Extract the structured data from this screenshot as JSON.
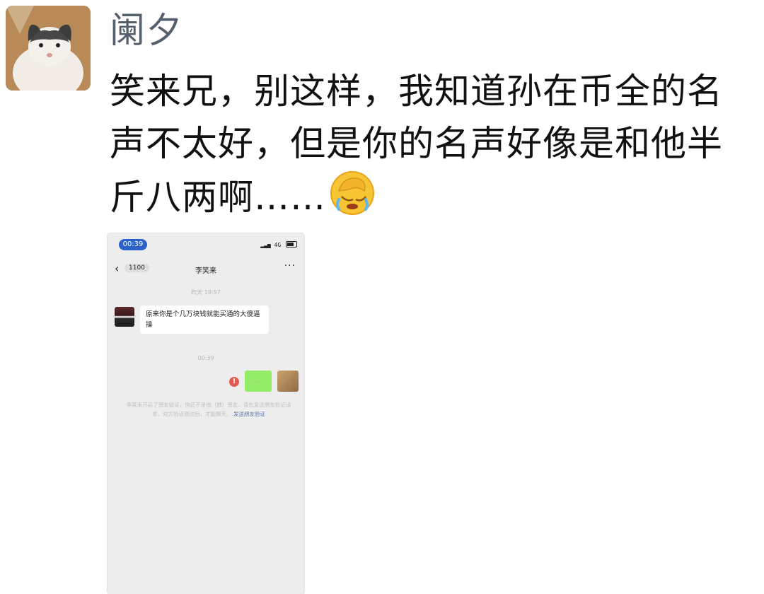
{
  "post": {
    "username": "阑夕",
    "text": "笑来兄，别这样，我知道孙在币全的名声不太好，但是你的名声好像是和他半斤八两啊……",
    "emoji": "face-palm-crying-emoji"
  },
  "screenshot": {
    "status_time": "00:39",
    "status_signal": "4G",
    "back_count": "1100",
    "chat_title": "李笑来",
    "timestamp_1": "昨天 19:57",
    "incoming_message": "原来你是个几万块钱就能买通的大傻逼 操",
    "timestamp_2": "00:39",
    "outgoing_message_placeholder": "...",
    "system_notice": "李笑来开启了朋友验证，你还不是他（她）朋友。请先发送朋友验证请求，对方验证通过后，才能聊天。",
    "system_link": "发送朋友验证"
  },
  "colors": {
    "username": "#55606e",
    "time_pill": "#2a62c9",
    "bubble_out": "#95ec69",
    "error_badge": "#e25a4f",
    "link": "#5c76a8"
  }
}
